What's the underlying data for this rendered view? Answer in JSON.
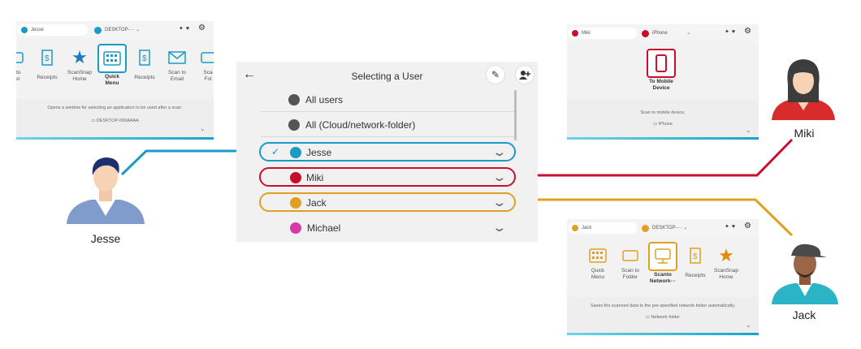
{
  "colors": {
    "jesse": "#1a9bc7",
    "miki": "#c8102e",
    "jack": "#e0a023",
    "michael": "#d63aa8",
    "accent_bar": "#1aa3c9"
  },
  "jesse_panel": {
    "user": "Jesse",
    "device": "DESKTOP-···",
    "tiles": [
      {
        "label": "n to\nder",
        "icon": "folder-icon"
      },
      {
        "label": "Receipts",
        "icon": "receipt-icon"
      },
      {
        "label": "ScanSnap\nHome",
        "icon": "star-icon"
      },
      {
        "label": "Quick\nMenu",
        "icon": "grid-icon"
      },
      {
        "label": "Receipts",
        "icon": "receipt-icon"
      },
      {
        "label": "Scan to\nEmail",
        "icon": "envelope-icon"
      },
      {
        "label": "Sca\nFol",
        "icon": "folder-icon"
      }
    ],
    "description": "Opens a window for selecting an application to be used after a scan.",
    "destination": "DESKTOP-000AAAA"
  },
  "miki_panel": {
    "user": "Miki",
    "device": "iPhone",
    "tile_label": "To Mobile\nDevice",
    "description": "Scan to mobile device.",
    "destination": "iPhone"
  },
  "jack_panel": {
    "user": "Jack",
    "device": "DESKTOP-···",
    "tiles": [
      {
        "label": "Quick\nMenu",
        "icon": "grid-icon"
      },
      {
        "label": "Scan to\nFolder",
        "icon": "folder-icon"
      },
      {
        "label": "Scanto\nNetwork···",
        "icon": "network-folder-icon"
      },
      {
        "label": "Receipts",
        "icon": "receipt-icon"
      },
      {
        "label": "ScanSnap\nHome",
        "icon": "star-icon"
      }
    ],
    "description": "Saves the scanned data to the pre-specified network folder automatically.",
    "destination": "Network folder"
  },
  "dialog": {
    "title": "Selecting a User",
    "rows": [
      {
        "label": "All users"
      },
      {
        "label": "All (Cloud/network-folder)"
      },
      {
        "label": "Jesse"
      },
      {
        "label": "Miki"
      },
      {
        "label": "Jack"
      },
      {
        "label": "Michael"
      }
    ]
  },
  "people": {
    "jesse": "Jesse",
    "miki": "Miki",
    "jack": "Jack"
  }
}
